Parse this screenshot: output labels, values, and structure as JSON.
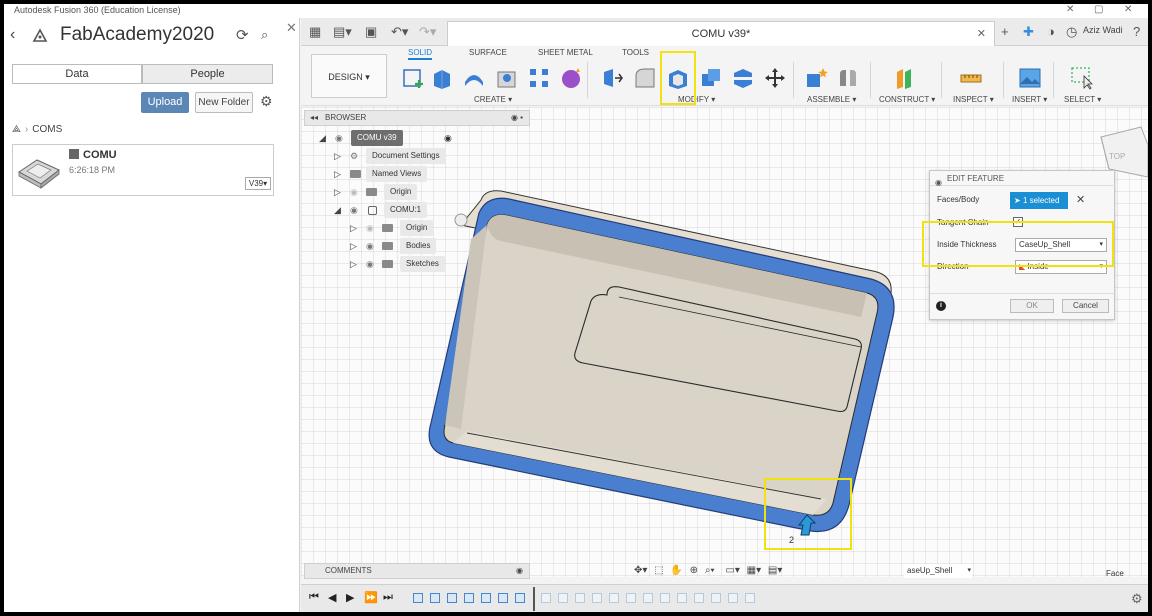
{
  "window": {
    "title": "Autodesk Fusion 360 (Education License)"
  },
  "data_panel": {
    "project_title": "FabAcademy2020",
    "tabs": [
      "Data",
      "People"
    ],
    "upload_label": "Upload",
    "new_folder_label": "New Folder",
    "breadcrumb": "COMS",
    "file": {
      "name": "COMU",
      "time": "6:26:18 PM",
      "version": "V39"
    }
  },
  "document": {
    "tab_title": "COMU v39*",
    "user": "Aziz Wadi"
  },
  "ribbon": {
    "workspace": "DESIGN",
    "tabs": [
      "SOLID",
      "SURFACE",
      "SHEET METAL",
      "TOOLS"
    ],
    "active_tab": "SOLID",
    "groups": [
      "CREATE",
      "MODIFY",
      "ASSEMBLE",
      "CONSTRUCT",
      "INSPECT",
      "INSERT",
      "SELECT"
    ]
  },
  "browser": {
    "header": "BROWSER",
    "rows": [
      {
        "label": "COMU v39"
      },
      {
        "label": "Document Settings"
      },
      {
        "label": "Named Views"
      },
      {
        "label": "Origin"
      },
      {
        "label": "COMU:1"
      },
      {
        "label": "Origin"
      },
      {
        "label": "Bodies"
      },
      {
        "label": "Sketches"
      }
    ]
  },
  "edit_feature": {
    "title": "EDIT FEATURE",
    "faces_label": "Faces/Body",
    "faces_value": "1 selected",
    "tangent_label": "Tangent Chain",
    "tangent_checked": true,
    "thickness_label": "Inside Thickness",
    "thickness_value": "CaseUp_Shell",
    "direction_label": "Direction",
    "direction_value": "Inside",
    "ok_label": "OK",
    "cancel_label": "Cancel"
  },
  "comments": {
    "header": "COMMENTS"
  },
  "status": {
    "field_value": "aseUp_Shell",
    "selection_filter": "Face"
  },
  "colors": {
    "accent": "#1a8fd3",
    "highlight": "#f0e20f",
    "shell_edge": "#4a7fd0"
  }
}
